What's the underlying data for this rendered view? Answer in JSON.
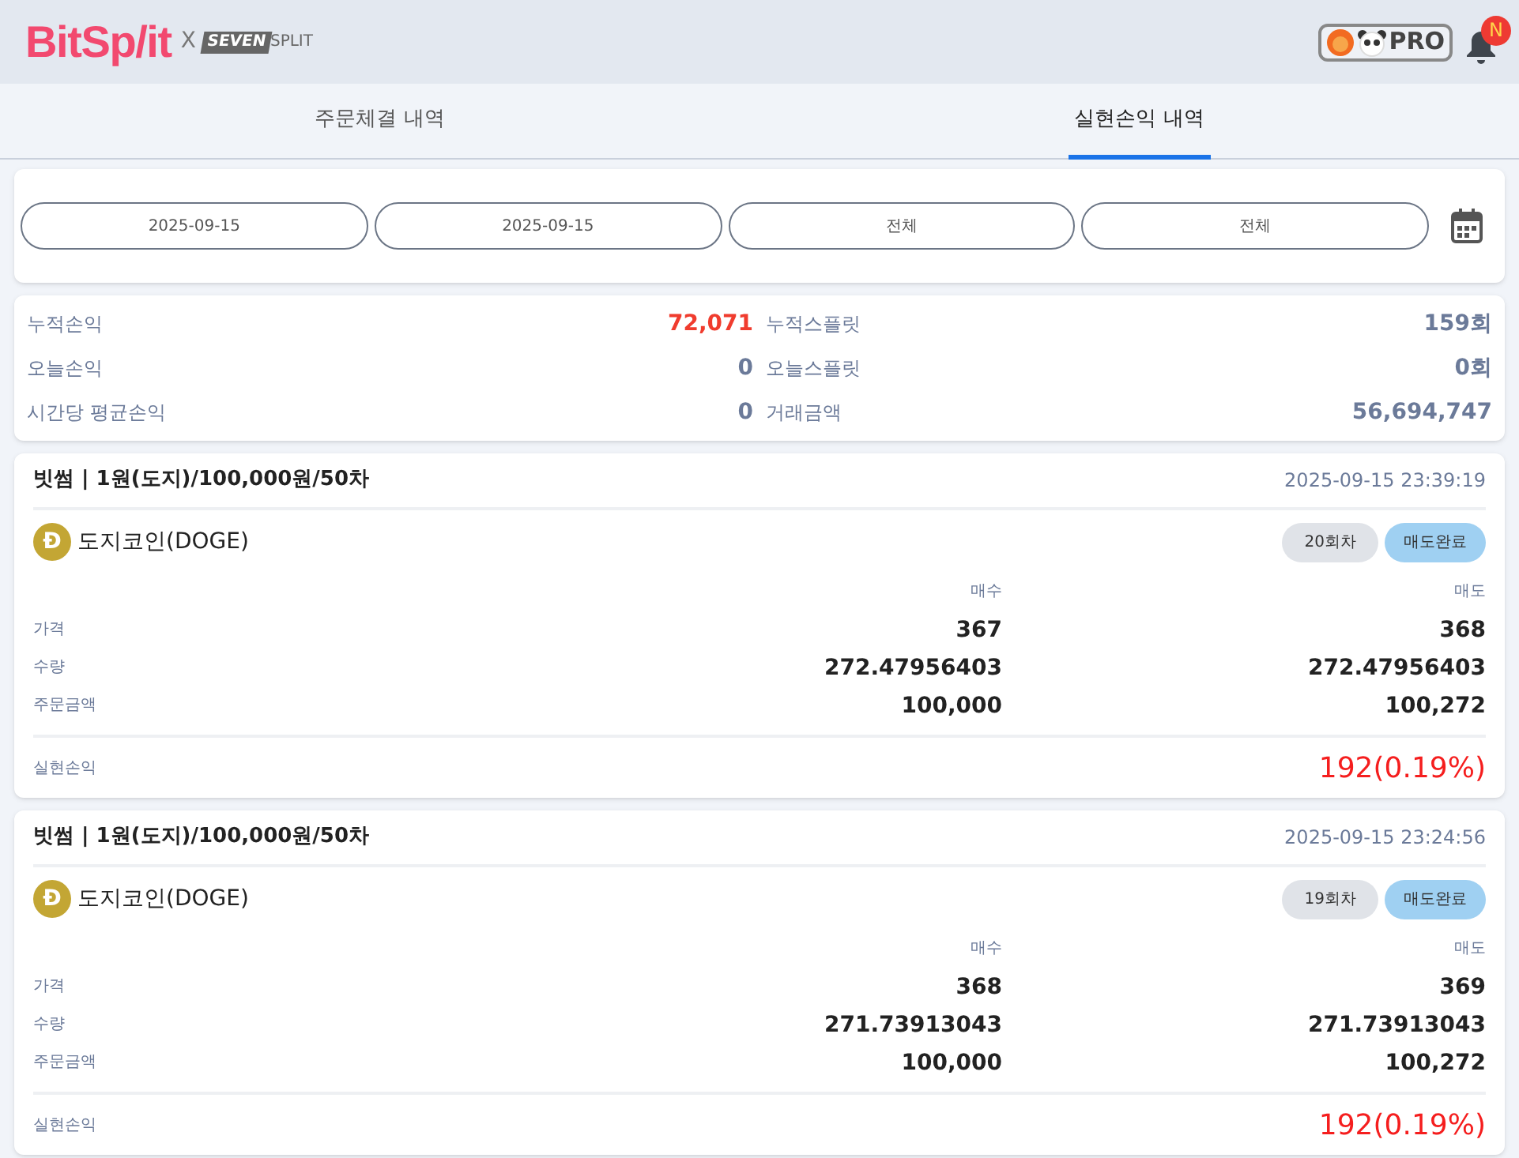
{
  "header": {
    "logo": "BitSp/it",
    "cross": "X",
    "partner_logo_box": "SEVEN",
    "partner_logo_text": "SPLIT",
    "pro_badge": "PRO",
    "notification_badge": "N"
  },
  "tabs": [
    {
      "label": "주문체결 내역",
      "selected": false
    },
    {
      "label": "실현손익 내역",
      "selected": true
    }
  ],
  "filters": [
    "2025-09-15",
    "2025-09-15",
    "전체",
    "전체"
  ],
  "summary": [
    {
      "label": "누적손익",
      "value": "72,071",
      "color": "#f03c2e"
    },
    {
      "label": "누적스플릿",
      "value": "159회",
      "color": "#6b7a99"
    },
    {
      "label": "오늘손익",
      "value": "0",
      "color": "#6b7a99"
    },
    {
      "label": "오늘스플릿",
      "value": "0회",
      "color": "#6b7a99"
    },
    {
      "label": "시간당 평균손익",
      "value": "0",
      "color": "#6b7a99"
    },
    {
      "label": "거래금액",
      "value": "56,694,747",
      "color": "#6b7a99"
    }
  ],
  "trades": [
    {
      "title": "빗썸 | 1원(도지)/100,000원/50차",
      "time": "2025-09-15 23:39:19",
      "coin_symbol": "Ð",
      "coin": "도지코인(DOGE)",
      "round": "20회차",
      "status": "매도완료",
      "buy_header": "매수",
      "sell_header": "매도",
      "rows": [
        {
          "label": "가격",
          "buy": "367",
          "sell": "368"
        },
        {
          "label": "수량",
          "buy": "272.47956403",
          "sell": "272.47956403"
        },
        {
          "label": "주문금액",
          "buy": "100,000",
          "sell": "100,272"
        }
      ],
      "pnl_label": "실현손익",
      "pnl": "192(0.19%)"
    },
    {
      "title": "빗썸 | 1원(도지)/100,000원/50차",
      "time": "2025-09-15 23:24:56",
      "coin_symbol": "Ð",
      "coin": "도지코인(DOGE)",
      "round": "19회차",
      "status": "매도완료",
      "buy_header": "매수",
      "sell_header": "매도",
      "rows": [
        {
          "label": "가격",
          "buy": "368",
          "sell": "369"
        },
        {
          "label": "수량",
          "buy": "271.73913043",
          "sell": "271.73913043"
        },
        {
          "label": "주문금액",
          "buy": "100,000",
          "sell": "100,272"
        }
      ],
      "pnl_label": "실현손익",
      "pnl": "192(0.19%)"
    }
  ]
}
